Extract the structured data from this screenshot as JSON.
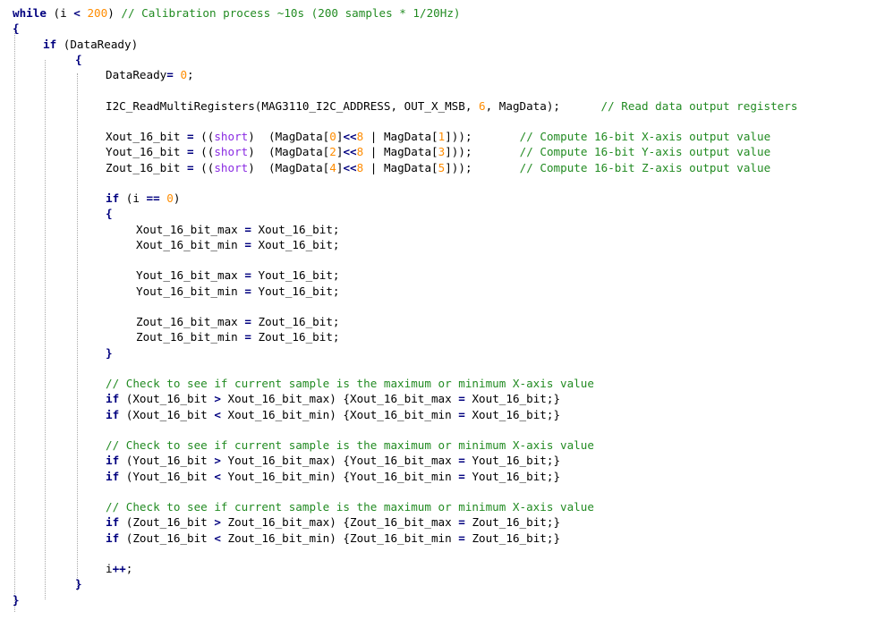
{
  "colors": {
    "background": "#ffffff",
    "text": "#000000",
    "keyword": "#00007f",
    "comment": "#228b22",
    "number": "#ff8c00",
    "type": "#8a2be2",
    "indent_guide": "#a8a8a8"
  },
  "code_lines": [
    {
      "indent": 0,
      "tokens": [
        {
          "t": "kw",
          "v": "while"
        },
        {
          "t": "plain",
          "v": " (i "
        },
        {
          "t": "op",
          "v": "<"
        },
        {
          "t": "plain",
          "v": " "
        },
        {
          "t": "number",
          "v": "200"
        },
        {
          "t": "plain",
          "v": ") "
        },
        {
          "t": "comment",
          "v": "// Calibration process ~10s (200 samples * 1/20Hz)"
        }
      ]
    },
    {
      "indent": 0,
      "tokens": [
        {
          "t": "op",
          "v": "{"
        }
      ]
    },
    {
      "indent": 1,
      "tokens": [
        {
          "t": "kw",
          "v": "if"
        },
        {
          "t": "plain",
          "v": " (DataReady)"
        }
      ]
    },
    {
      "indent": 2,
      "tokens": [
        {
          "t": "op",
          "v": "{"
        }
      ]
    },
    {
      "indent": 3,
      "tokens": [
        {
          "t": "plain",
          "v": "DataReady"
        },
        {
          "t": "op",
          "v": "="
        },
        {
          "t": "plain",
          "v": " "
        },
        {
          "t": "number",
          "v": "0"
        },
        {
          "t": "plain",
          "v": ";"
        }
      ]
    },
    {
      "indent": 3,
      "tokens": []
    },
    {
      "indent": 3,
      "tokens": [
        {
          "t": "plain",
          "v": "I2C_ReadMultiRegisters(MAG3110_I2C_ADDRESS, OUT_X_MSB, "
        },
        {
          "t": "number",
          "v": "6"
        },
        {
          "t": "plain",
          "v": ", MagData);      "
        },
        {
          "t": "comment",
          "v": "// Read data output registers"
        }
      ]
    },
    {
      "indent": 3,
      "tokens": []
    },
    {
      "indent": 3,
      "tokens": [
        {
          "t": "plain",
          "v": "Xout_16_bit "
        },
        {
          "t": "op",
          "v": "="
        },
        {
          "t": "plain",
          "v": " (("
        },
        {
          "t": "type",
          "v": "short"
        },
        {
          "t": "plain",
          "v": ")  (MagData["
        },
        {
          "t": "number",
          "v": "0"
        },
        {
          "t": "plain",
          "v": "]"
        },
        {
          "t": "op",
          "v": "<<"
        },
        {
          "t": "number",
          "v": "8"
        },
        {
          "t": "plain",
          "v": " | MagData["
        },
        {
          "t": "number",
          "v": "1"
        },
        {
          "t": "plain",
          "v": "]));       "
        },
        {
          "t": "comment",
          "v": "// Compute 16-bit X-axis output value"
        }
      ]
    },
    {
      "indent": 3,
      "tokens": [
        {
          "t": "plain",
          "v": "Yout_16_bit "
        },
        {
          "t": "op",
          "v": "="
        },
        {
          "t": "plain",
          "v": " (("
        },
        {
          "t": "type",
          "v": "short"
        },
        {
          "t": "plain",
          "v": ")  (MagData["
        },
        {
          "t": "number",
          "v": "2"
        },
        {
          "t": "plain",
          "v": "]"
        },
        {
          "t": "op",
          "v": "<<"
        },
        {
          "t": "number",
          "v": "8"
        },
        {
          "t": "plain",
          "v": " | MagData["
        },
        {
          "t": "number",
          "v": "3"
        },
        {
          "t": "plain",
          "v": "]));       "
        },
        {
          "t": "comment",
          "v": "// Compute 16-bit Y-axis output value"
        }
      ]
    },
    {
      "indent": 3,
      "tokens": [
        {
          "t": "plain",
          "v": "Zout_16_bit "
        },
        {
          "t": "op",
          "v": "="
        },
        {
          "t": "plain",
          "v": " (("
        },
        {
          "t": "type",
          "v": "short"
        },
        {
          "t": "plain",
          "v": ")  (MagData["
        },
        {
          "t": "number",
          "v": "4"
        },
        {
          "t": "plain",
          "v": "]"
        },
        {
          "t": "op",
          "v": "<<"
        },
        {
          "t": "number",
          "v": "8"
        },
        {
          "t": "plain",
          "v": " | MagData["
        },
        {
          "t": "number",
          "v": "5"
        },
        {
          "t": "plain",
          "v": "]));       "
        },
        {
          "t": "comment",
          "v": "// Compute 16-bit Z-axis output value"
        }
      ]
    },
    {
      "indent": 3,
      "tokens": []
    },
    {
      "indent": 3,
      "tokens": [
        {
          "t": "kw",
          "v": "if"
        },
        {
          "t": "plain",
          "v": " (i "
        },
        {
          "t": "op",
          "v": "=="
        },
        {
          "t": "plain",
          "v": " "
        },
        {
          "t": "number",
          "v": "0"
        },
        {
          "t": "plain",
          "v": ")"
        }
      ]
    },
    {
      "indent": 3,
      "tokens": [
        {
          "t": "op",
          "v": "{"
        }
      ]
    },
    {
      "indent": 4,
      "tokens": [
        {
          "t": "plain",
          "v": "Xout_16_bit_max "
        },
        {
          "t": "op",
          "v": "="
        },
        {
          "t": "plain",
          "v": " Xout_16_bit;"
        }
      ]
    },
    {
      "indent": 4,
      "tokens": [
        {
          "t": "plain",
          "v": "Xout_16_bit_min "
        },
        {
          "t": "op",
          "v": "="
        },
        {
          "t": "plain",
          "v": " Xout_16_bit;"
        }
      ]
    },
    {
      "indent": 4,
      "tokens": []
    },
    {
      "indent": 4,
      "tokens": [
        {
          "t": "plain",
          "v": "Yout_16_bit_max "
        },
        {
          "t": "op",
          "v": "="
        },
        {
          "t": "plain",
          "v": " Yout_16_bit;"
        }
      ]
    },
    {
      "indent": 4,
      "tokens": [
        {
          "t": "plain",
          "v": "Yout_16_bit_min "
        },
        {
          "t": "op",
          "v": "="
        },
        {
          "t": "plain",
          "v": " Yout_16_bit;"
        }
      ]
    },
    {
      "indent": 4,
      "tokens": []
    },
    {
      "indent": 4,
      "tokens": [
        {
          "t": "plain",
          "v": "Zout_16_bit_max "
        },
        {
          "t": "op",
          "v": "="
        },
        {
          "t": "plain",
          "v": " Zout_16_bit;"
        }
      ]
    },
    {
      "indent": 4,
      "tokens": [
        {
          "t": "plain",
          "v": "Zout_16_bit_min "
        },
        {
          "t": "op",
          "v": "="
        },
        {
          "t": "plain",
          "v": " Zout_16_bit;"
        }
      ]
    },
    {
      "indent": 3,
      "tokens": [
        {
          "t": "op",
          "v": "}"
        }
      ]
    },
    {
      "indent": 3,
      "tokens": []
    },
    {
      "indent": 3,
      "tokens": [
        {
          "t": "comment",
          "v": "// Check to see if current sample is the maximum or minimum X-axis value"
        }
      ]
    },
    {
      "indent": 3,
      "tokens": [
        {
          "t": "kw",
          "v": "if"
        },
        {
          "t": "plain",
          "v": " (Xout_16_bit "
        },
        {
          "t": "op",
          "v": ">"
        },
        {
          "t": "plain",
          "v": " Xout_16_bit_max) {Xout_16_bit_max "
        },
        {
          "t": "op",
          "v": "="
        },
        {
          "t": "plain",
          "v": " Xout_16_bit;}"
        }
      ]
    },
    {
      "indent": 3,
      "tokens": [
        {
          "t": "kw",
          "v": "if"
        },
        {
          "t": "plain",
          "v": " (Xout_16_bit "
        },
        {
          "t": "op",
          "v": "<"
        },
        {
          "t": "plain",
          "v": " Xout_16_bit_min) {Xout_16_bit_min "
        },
        {
          "t": "op",
          "v": "="
        },
        {
          "t": "plain",
          "v": " Xout_16_bit;}"
        }
      ]
    },
    {
      "indent": 3,
      "tokens": []
    },
    {
      "indent": 3,
      "tokens": [
        {
          "t": "comment",
          "v": "// Check to see if current sample is the maximum or minimum X-axis value"
        }
      ]
    },
    {
      "indent": 3,
      "tokens": [
        {
          "t": "kw",
          "v": "if"
        },
        {
          "t": "plain",
          "v": " (Yout_16_bit "
        },
        {
          "t": "op",
          "v": ">"
        },
        {
          "t": "plain",
          "v": " Yout_16_bit_max) {Yout_16_bit_max "
        },
        {
          "t": "op",
          "v": "="
        },
        {
          "t": "plain",
          "v": " Yout_16_bit;}"
        }
      ]
    },
    {
      "indent": 3,
      "tokens": [
        {
          "t": "kw",
          "v": "if"
        },
        {
          "t": "plain",
          "v": " (Yout_16_bit "
        },
        {
          "t": "op",
          "v": "<"
        },
        {
          "t": "plain",
          "v": " Yout_16_bit_min) {Yout_16_bit_min "
        },
        {
          "t": "op",
          "v": "="
        },
        {
          "t": "plain",
          "v": " Yout_16_bit;}"
        }
      ]
    },
    {
      "indent": 3,
      "tokens": []
    },
    {
      "indent": 3,
      "tokens": [
        {
          "t": "comment",
          "v": "// Check to see if current sample is the maximum or minimum X-axis value"
        }
      ]
    },
    {
      "indent": 3,
      "tokens": [
        {
          "t": "kw",
          "v": "if"
        },
        {
          "t": "plain",
          "v": " (Zout_16_bit "
        },
        {
          "t": "op",
          "v": ">"
        },
        {
          "t": "plain",
          "v": " Zout_16_bit_max) {Zout_16_bit_max "
        },
        {
          "t": "op",
          "v": "="
        },
        {
          "t": "plain",
          "v": " Zout_16_bit;}"
        }
      ]
    },
    {
      "indent": 3,
      "tokens": [
        {
          "t": "kw",
          "v": "if"
        },
        {
          "t": "plain",
          "v": " (Zout_16_bit "
        },
        {
          "t": "op",
          "v": "<"
        },
        {
          "t": "plain",
          "v": " Zout_16_bit_min) {Zout_16_bit_min "
        },
        {
          "t": "op",
          "v": "="
        },
        {
          "t": "plain",
          "v": " Zout_16_bit;}"
        }
      ]
    },
    {
      "indent": 3,
      "tokens": []
    },
    {
      "indent": 3,
      "tokens": [
        {
          "t": "plain",
          "v": "i"
        },
        {
          "t": "op",
          "v": "++"
        },
        {
          "t": "plain",
          "v": ";"
        }
      ]
    },
    {
      "indent": 2,
      "tokens": [
        {
          "t": "op",
          "v": "}"
        }
      ]
    },
    {
      "indent": 0,
      "tokens": [
        {
          "t": "op",
          "v": "}"
        }
      ]
    }
  ]
}
